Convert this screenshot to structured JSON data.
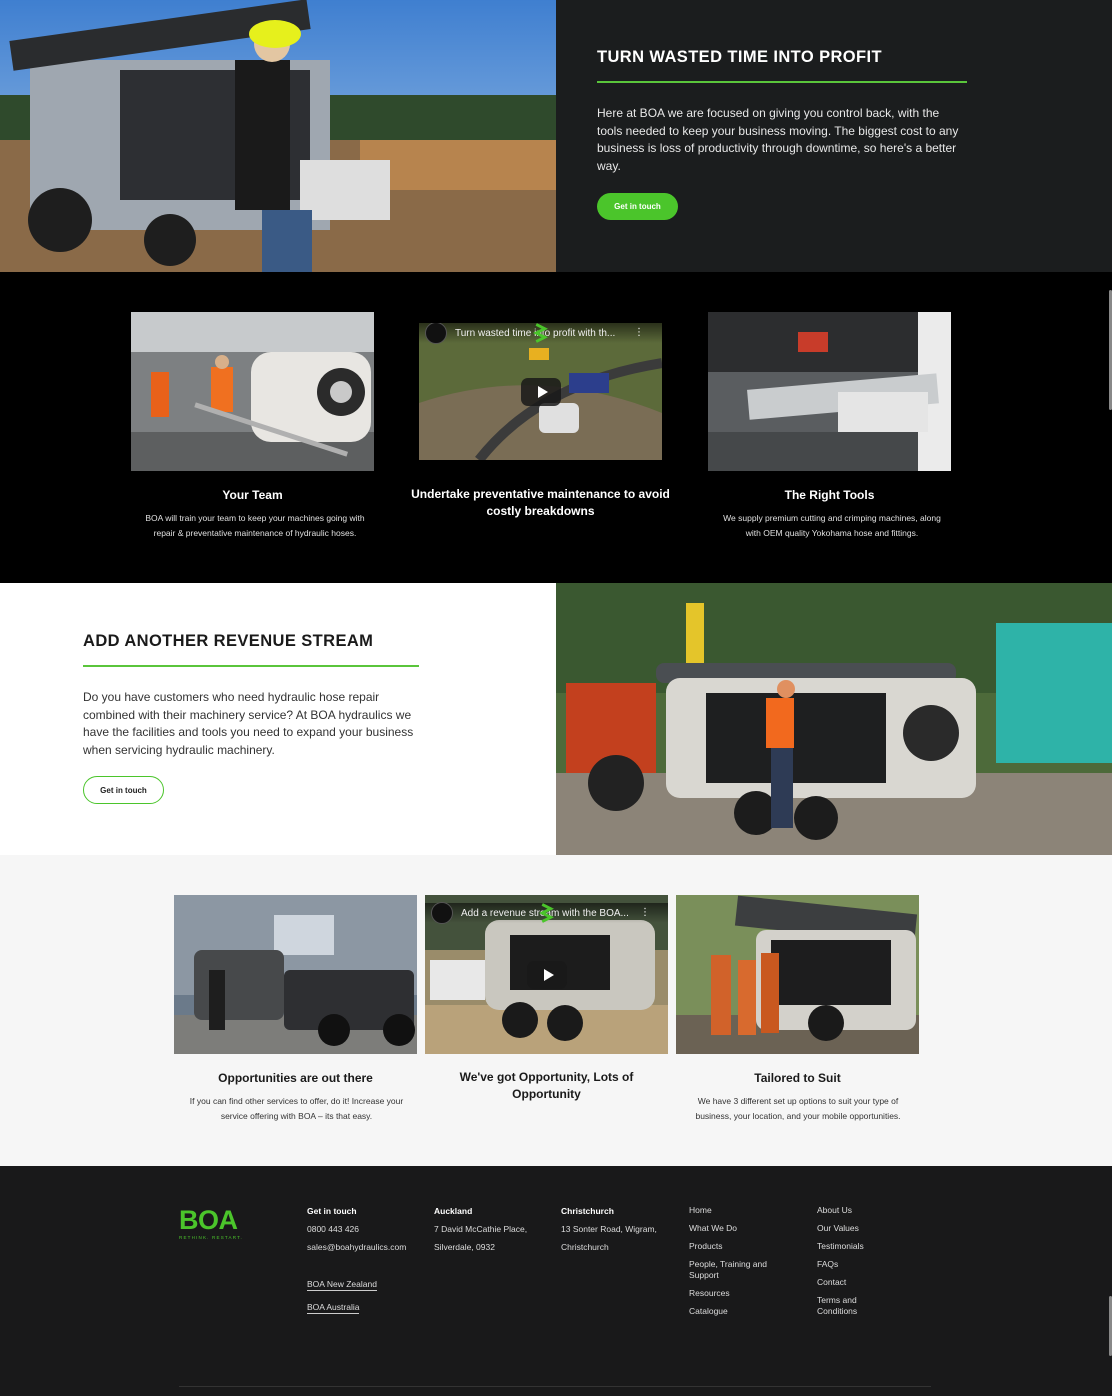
{
  "hero": {
    "title": "TURN WASTED TIME INTO PROFIT",
    "body": "Here at BOA we are focused on giving you control back, with the tools needed to keep your business moving. The biggest cost to any business is loss of productivity through downtime, so here's a better way.",
    "cta": "Get in touch",
    "accent": "#4bc52b"
  },
  "cards_dark": [
    {
      "title": "Your Team",
      "desc": "BOA will train your team to keep your machines going with repair & preventative maintenance of hydraulic hoses."
    },
    {
      "title": "Undertake preventative maintenance to avoid costly breakdowns",
      "video_title": "Turn wasted time into profit with th..."
    },
    {
      "title": "The Right Tools",
      "desc": "We supply premium cutting and crimping machines, along with OEM quality Yokohama hose and fittings."
    }
  ],
  "revenue": {
    "title": "ADD ANOTHER REVENUE STREAM",
    "body": "Do you have customers who need hydraulic hose repair combined with their machinery service? At BOA hydraulics we have the facilities and tools you need to expand your business when servicing hydraulic machinery.",
    "cta": "Get in touch"
  },
  "cards_light": [
    {
      "title": "Opportunities are out there",
      "desc": "If you can find other services to offer, do it! Increase your service offering with BOA – its that easy."
    },
    {
      "title": "We've got Opportunity, Lots of Opportunity",
      "video_title": "Add a revenue stream with the BOA..."
    },
    {
      "title": "Tailored to Suit",
      "desc": "We have 3 different set up options to suit your type of business, your location, and your mobile opportunities."
    }
  ],
  "footer": {
    "logo": "BOA",
    "tagline": "RETHINK. RESTART.",
    "contact": {
      "heading": "Get in touch",
      "phone": "0800 443 426",
      "email": "sales@boahydraulics.com",
      "sites": [
        "BOA New Zealand",
        "BOA Australia"
      ]
    },
    "auckland": {
      "heading": "Auckland",
      "lines": [
        "7 David McCathie Place,",
        "Silverdale, 0932"
      ]
    },
    "christchurch": {
      "heading": "Christchurch",
      "lines": [
        "13 Sonter Road, Wigram,",
        "Christchurch"
      ]
    },
    "nav1": [
      "Home",
      "What We Do",
      "Products",
      "People, Training and Support",
      "Resources",
      "Catalogue"
    ],
    "nav2": [
      "About Us",
      "Our Values",
      "Testimonials",
      "FAQs",
      "Contact",
      "Terms and Conditions"
    ]
  }
}
